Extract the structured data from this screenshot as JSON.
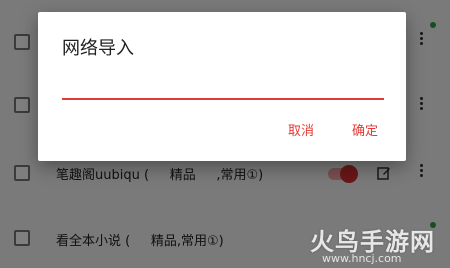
{
  "list": {
    "items": [
      {
        "label": ""
      },
      {
        "label": ""
      },
      {
        "label": "笔趣阁uubiqu (     精品     ,常用①)"
      },
      {
        "label": "看全本小说 (     精品,常用①)"
      }
    ]
  },
  "dialog": {
    "title": "网络导入",
    "input_value": "",
    "cancel_label": "取消",
    "confirm_label": "确定",
    "accent_color": "#e53935"
  },
  "watermark": {
    "logo_text": "火鸟手游网",
    "url": "www.hncj.com"
  }
}
